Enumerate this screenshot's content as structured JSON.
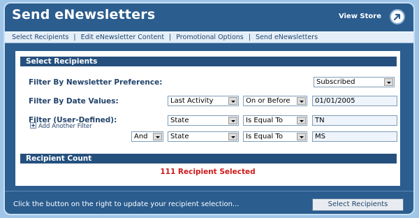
{
  "header": {
    "title": "Send eNewsletters",
    "view_store_label": "View Store"
  },
  "tabs": [
    {
      "label": "Select Recipients"
    },
    {
      "label": "Edit eNewsletter Content"
    },
    {
      "label": "Promotional Options"
    },
    {
      "label": "Send eNewsletters"
    }
  ],
  "tab_separator": "|",
  "select_recipients": {
    "heading": "Select Recipients",
    "newsletter_pref": {
      "label": "Filter By Newsletter Preference:",
      "value": "Subscribed"
    },
    "date_values": {
      "label": "Filter By Date Values:",
      "field": "Last Activity",
      "operator": "On or Before",
      "value": "01/01/2005"
    },
    "user_defined": {
      "label": "Filter (User-Defined):",
      "add_filter_label": "Add Another Filter",
      "filters": [
        {
          "conjunction": "",
          "field": "State",
          "operator": "Is Equal To",
          "value": "TN"
        },
        {
          "conjunction": "And",
          "field": "State",
          "operator": "Is Equal To",
          "value": "MS"
        }
      ]
    }
  },
  "recipient_count": {
    "heading": "Recipient Count",
    "text": "111 Recipient Selected"
  },
  "footer": {
    "instruction": "Click the button on the right to update your recipient selection...",
    "button_label": "Select Recipients"
  },
  "colors": {
    "frame": "#2b5d8e",
    "section_header": "#25507e",
    "count_text": "#d01818",
    "page_background": "#9fc6e8"
  }
}
